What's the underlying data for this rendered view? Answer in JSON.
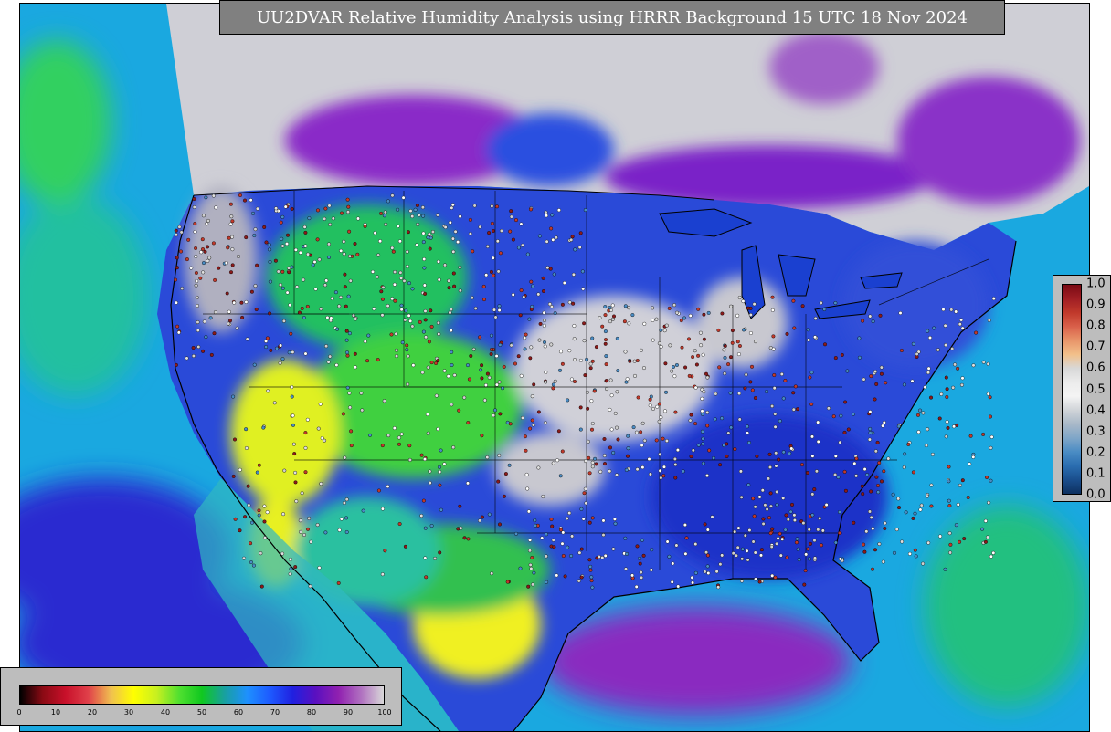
{
  "title": "UU2DVAR Relative Humidity Analysis using HRRR Background 15 UTC 18 Nov 2024",
  "rh_legend": {
    "ticks": [
      "0",
      "10",
      "20",
      "30",
      "40",
      "50",
      "60",
      "70",
      "80",
      "90",
      "100"
    ],
    "colors": [
      "#000000",
      "#8b0a14",
      "#c8102a",
      "#e0404a",
      "#f0c050",
      "#ffff00",
      "#c8f020",
      "#50e030",
      "#10c820",
      "#18a0a0",
      "#1e90ff",
      "#1e5aff",
      "#2020e0",
      "#5a10c0",
      "#9020b0",
      "#b070c0",
      "#d8d8d8"
    ]
  },
  "ratio_legend": {
    "ticks": [
      "1.0",
      "0.9",
      "0.8",
      "0.7",
      "0.6",
      "0.5",
      "0.4",
      "0.3",
      "0.2",
      "0.1",
      "0.0"
    ],
    "colors": [
      "#7a0a14",
      "#a01e24",
      "#c0392b",
      "#d9604a",
      "#e8956a",
      "#f2c08a",
      "#d8d8d8",
      "#ececec",
      "#f4f4f4",
      "#d0d4d8",
      "#a8b8c8",
      "#7fa6c8",
      "#4a8cc4",
      "#2a6db0",
      "#1a4e8c",
      "#0d3060"
    ]
  },
  "map": {
    "ocean_color": "#1aa8e0",
    "dry_color": "#ffff00",
    "moist_color": "#2020e0",
    "saturated_color": "#d0d0d0",
    "land_color": "#2a4ad8"
  }
}
